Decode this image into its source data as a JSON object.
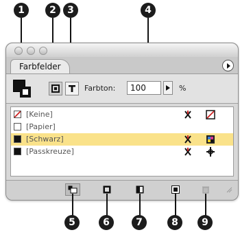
{
  "callouts": {
    "top": [
      "1",
      "2",
      "3",
      "4"
    ],
    "bottom": [
      "5",
      "6",
      "7",
      "8",
      "9"
    ]
  },
  "panel": {
    "tab_label": "Farbfelder",
    "tint_label": "Farbton:",
    "tint_value": "100",
    "percent": "%"
  },
  "swatches": [
    {
      "name": "[Keine]",
      "color": "#ffffff"
    },
    {
      "name": "[Papier]",
      "color": "#ffffff"
    },
    {
      "name": "[Schwarz]",
      "color": "#111111"
    },
    {
      "name": "[Passkreuze]",
      "color": "#111111"
    }
  ],
  "colors": {
    "selection": "#fae28a",
    "none_red": "#cc2222"
  }
}
